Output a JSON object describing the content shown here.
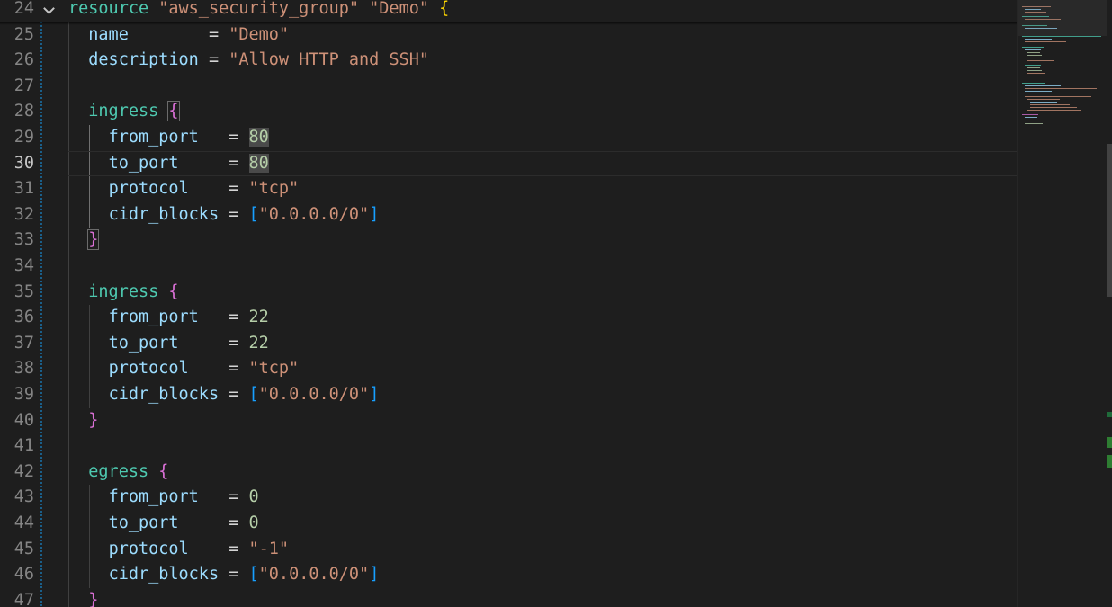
{
  "editor": {
    "active_line": 30,
    "colors": {
      "background": "#1e1e1e",
      "attribute": "#9cdcfe",
      "block_type": "#4ec9b0",
      "string": "#ce9178",
      "number": "#b5cea8",
      "bracket_level_1": "#ffd700",
      "bracket_level_2": "#da70d6",
      "bracket_level_3": "#179fff",
      "modified_gutter": "#2e7d32"
    },
    "lines": [
      {
        "num": "24",
        "fold": "chevron-down-icon",
        "tokens": [
          {
            "t": "tl",
            "v": "resource"
          },
          {
            "t": "op",
            "v": " "
          },
          {
            "t": "str",
            "v": "\"aws_security_group\""
          },
          {
            "t": "op",
            "v": " "
          },
          {
            "t": "str",
            "v": "\"Demo\""
          },
          {
            "t": "op",
            "v": " "
          },
          {
            "t": "b1",
            "v": "{"
          }
        ]
      },
      {
        "num": "25",
        "tokens": [
          {
            "t": "op",
            "v": "  "
          },
          {
            "t": "kw",
            "v": "name"
          },
          {
            "t": "op",
            "v": "        = "
          },
          {
            "t": "str",
            "v": "\"Demo\""
          }
        ]
      },
      {
        "num": "26",
        "tokens": [
          {
            "t": "op",
            "v": "  "
          },
          {
            "t": "kw",
            "v": "description"
          },
          {
            "t": "op",
            "v": " = "
          },
          {
            "t": "str",
            "v": "\"Allow HTTP and SSH\""
          }
        ]
      },
      {
        "num": "27",
        "tokens": []
      },
      {
        "num": "28",
        "tokens": [
          {
            "t": "op",
            "v": "  "
          },
          {
            "t": "tl",
            "v": "ingress"
          },
          {
            "t": "op",
            "v": " "
          },
          {
            "t": "b2",
            "v": "{",
            "bm": true
          }
        ]
      },
      {
        "num": "29",
        "tokens": [
          {
            "t": "op",
            "v": "    "
          },
          {
            "t": "kw",
            "v": "from_port"
          },
          {
            "t": "op",
            "v": "   = "
          },
          {
            "t": "num",
            "v": "80",
            "hl": true
          }
        ]
      },
      {
        "num": "30",
        "tokens": [
          {
            "t": "op",
            "v": "    "
          },
          {
            "t": "kw",
            "v": "to_port"
          },
          {
            "t": "op",
            "v": "     = "
          },
          {
            "t": "num",
            "v": "80",
            "hl": true
          }
        ]
      },
      {
        "num": "31",
        "tokens": [
          {
            "t": "op",
            "v": "    "
          },
          {
            "t": "kw",
            "v": "protocol"
          },
          {
            "t": "op",
            "v": "    = "
          },
          {
            "t": "str",
            "v": "\"tcp\""
          }
        ]
      },
      {
        "num": "32",
        "tokens": [
          {
            "t": "op",
            "v": "    "
          },
          {
            "t": "kw",
            "v": "cidr_blocks"
          },
          {
            "t": "op",
            "v": " = "
          },
          {
            "t": "b3",
            "v": "["
          },
          {
            "t": "str",
            "v": "\"0.0.0.0/0\""
          },
          {
            "t": "b3",
            "v": "]"
          }
        ]
      },
      {
        "num": "33",
        "tokens": [
          {
            "t": "op",
            "v": "  "
          },
          {
            "t": "b2",
            "v": "}",
            "bm": true
          }
        ]
      },
      {
        "num": "34",
        "tokens": []
      },
      {
        "num": "35",
        "tokens": [
          {
            "t": "op",
            "v": "  "
          },
          {
            "t": "tl",
            "v": "ingress"
          },
          {
            "t": "op",
            "v": " "
          },
          {
            "t": "b2",
            "v": "{"
          }
        ]
      },
      {
        "num": "36",
        "tokens": [
          {
            "t": "op",
            "v": "    "
          },
          {
            "t": "kw",
            "v": "from_port"
          },
          {
            "t": "op",
            "v": "   = "
          },
          {
            "t": "num",
            "v": "22"
          }
        ]
      },
      {
        "num": "37",
        "tokens": [
          {
            "t": "op",
            "v": "    "
          },
          {
            "t": "kw",
            "v": "to_port"
          },
          {
            "t": "op",
            "v": "     = "
          },
          {
            "t": "num",
            "v": "22"
          }
        ]
      },
      {
        "num": "38",
        "tokens": [
          {
            "t": "op",
            "v": "    "
          },
          {
            "t": "kw",
            "v": "protocol"
          },
          {
            "t": "op",
            "v": "    = "
          },
          {
            "t": "str",
            "v": "\"tcp\""
          }
        ]
      },
      {
        "num": "39",
        "tokens": [
          {
            "t": "op",
            "v": "    "
          },
          {
            "t": "kw",
            "v": "cidr_blocks"
          },
          {
            "t": "op",
            "v": " = "
          },
          {
            "t": "b3",
            "v": "["
          },
          {
            "t": "str",
            "v": "\"0.0.0.0/0\""
          },
          {
            "t": "b3",
            "v": "]"
          }
        ]
      },
      {
        "num": "40",
        "tokens": [
          {
            "t": "op",
            "v": "  "
          },
          {
            "t": "b2",
            "v": "}"
          }
        ]
      },
      {
        "num": "41",
        "tokens": []
      },
      {
        "num": "42",
        "tokens": [
          {
            "t": "op",
            "v": "  "
          },
          {
            "t": "tl",
            "v": "egress"
          },
          {
            "t": "op",
            "v": " "
          },
          {
            "t": "b2",
            "v": "{"
          }
        ]
      },
      {
        "num": "43",
        "tokens": [
          {
            "t": "op",
            "v": "    "
          },
          {
            "t": "kw",
            "v": "from_port"
          },
          {
            "t": "op",
            "v": "   = "
          },
          {
            "t": "num",
            "v": "0"
          }
        ]
      },
      {
        "num": "44",
        "tokens": [
          {
            "t": "op",
            "v": "    "
          },
          {
            "t": "kw",
            "v": "to_port"
          },
          {
            "t": "op",
            "v": "     = "
          },
          {
            "t": "num",
            "v": "0"
          }
        ]
      },
      {
        "num": "45",
        "tokens": [
          {
            "t": "op",
            "v": "    "
          },
          {
            "t": "kw",
            "v": "protocol"
          },
          {
            "t": "op",
            "v": "    = "
          },
          {
            "t": "str",
            "v": "\"-1\""
          }
        ]
      },
      {
        "num": "46",
        "tokens": [
          {
            "t": "op",
            "v": "    "
          },
          {
            "t": "kw",
            "v": "cidr_blocks"
          },
          {
            "t": "op",
            "v": " = "
          },
          {
            "t": "b3",
            "v": "["
          },
          {
            "t": "str",
            "v": "\"0.0.0.0/0\""
          },
          {
            "t": "b3",
            "v": "]"
          }
        ]
      },
      {
        "num": "47",
        "tokens": [
          {
            "t": "op",
            "v": "  "
          },
          {
            "t": "b2",
            "v": "}"
          }
        ]
      }
    ]
  }
}
